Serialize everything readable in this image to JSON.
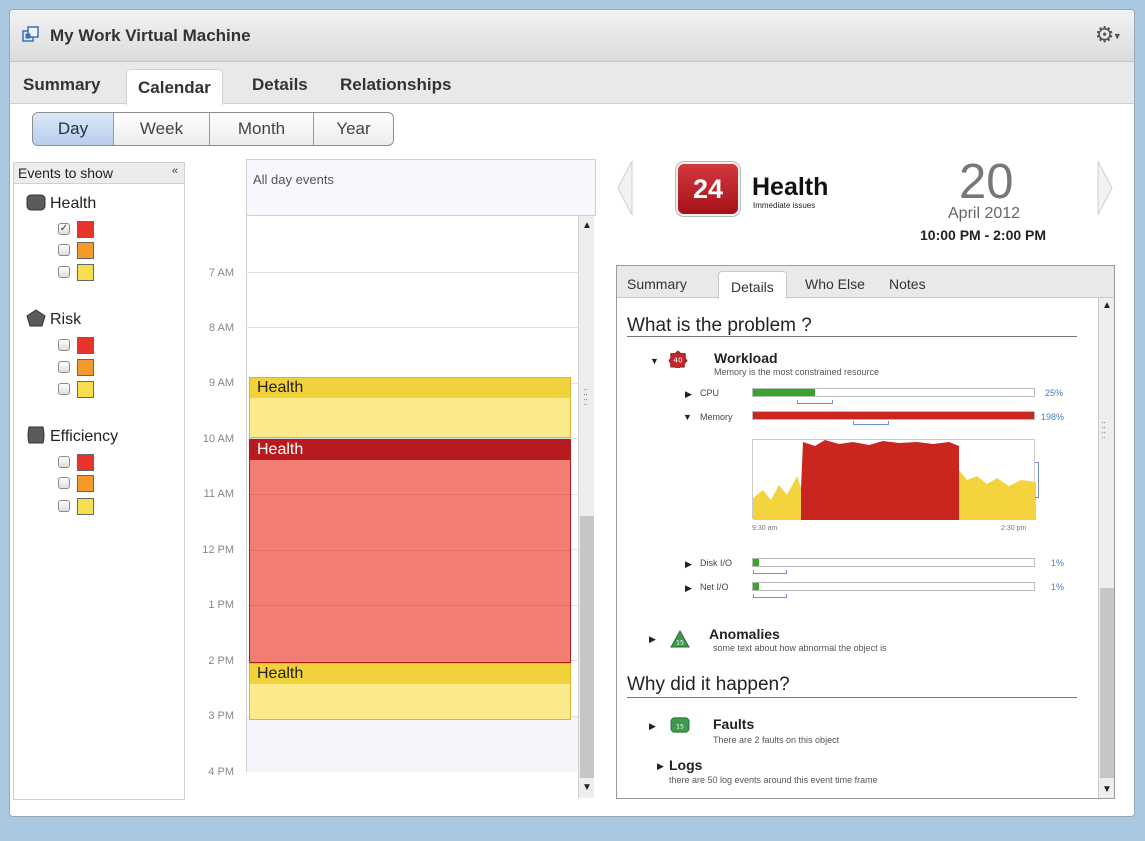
{
  "window": {
    "title": "My Work Virtual Machine"
  },
  "tabs": [
    "Summary",
    "Calendar",
    "Details",
    "Relationships"
  ],
  "active_tab": "Calendar",
  "view_toggle": {
    "options": [
      "Day",
      "Week",
      "Month",
      "Year"
    ],
    "selected": "Day"
  },
  "events_panel": {
    "header": "Events to show",
    "groups": [
      {
        "label": "Health",
        "icon": "square-badge-icon",
        "rows": [
          {
            "checked": true,
            "color": "#e8332b"
          },
          {
            "checked": false,
            "color": "#f49a2a"
          },
          {
            "checked": false,
            "color": "#f7de4e"
          }
        ]
      },
      {
        "label": "Risk",
        "icon": "pentagon-badge-icon",
        "rows": [
          {
            "checked": false,
            "color": "#e8332b"
          },
          {
            "checked": false,
            "color": "#f49a2a"
          },
          {
            "checked": false,
            "color": "#f7de4e"
          }
        ]
      },
      {
        "label": "Efficiency",
        "icon": "rounded-badge-icon",
        "rows": [
          {
            "checked": false,
            "color": "#e8332b"
          },
          {
            "checked": false,
            "color": "#f49a2a"
          },
          {
            "checked": false,
            "color": "#f7de4e"
          }
        ]
      }
    ]
  },
  "calendar": {
    "all_day_label": "All day events",
    "hours": [
      "7 AM",
      "8 AM",
      "9 AM",
      "10 AM",
      "11 AM",
      "12 PM",
      "1 PM",
      "2 PM",
      "3 PM",
      "4 PM"
    ],
    "events": [
      {
        "label": "Health",
        "start": "9 AM",
        "end": "10 AM",
        "severity": "warning"
      },
      {
        "label": "Health",
        "start": "10 AM",
        "end": "2 PM",
        "severity": "critical"
      },
      {
        "label": "Health",
        "start": "2 PM",
        "end": "3 PM",
        "severity": "warning"
      }
    ]
  },
  "detail_header": {
    "badge_value": "24",
    "title": "Health",
    "subtitle": "Immediate issues",
    "day": "20",
    "month_year": "April 2012",
    "time_range": "10:00 PM - 2:00 PM"
  },
  "detail_tabs": {
    "tabs": [
      "Summary",
      "Details",
      "Who Else",
      "Notes"
    ],
    "active": "Details"
  },
  "problem": {
    "heading": "What is the problem ?",
    "workload": {
      "badge": "40",
      "title": "Workload",
      "subtitle": "Memory is the most constrained resource",
      "metrics": [
        {
          "label": "CPU",
          "pct_text": "25%",
          "fill": 0.22,
          "color": "#3aa32b",
          "expanded": false
        },
        {
          "label": "Memory",
          "pct_text": "198%",
          "fill": 1.0,
          "color": "#c8261f",
          "expanded": true
        },
        {
          "label": "Disk I/O",
          "pct_text": "1%",
          "fill": 0.02,
          "color": "#3aa32b",
          "expanded": false
        },
        {
          "label": "Net I/O",
          "pct_text": "1%",
          "fill": 0.02,
          "color": "#3aa32b",
          "expanded": false
        }
      ],
      "chart": {
        "x_start": "9:30 am",
        "x_end": "2:30 pm"
      }
    },
    "anomalies": {
      "badge": "15",
      "title": "Anomalies",
      "subtitle": "some text about how abnormal the object is"
    }
  },
  "cause": {
    "heading": "Why did it happen?",
    "faults": {
      "badge": "15",
      "title": "Faults",
      "subtitle": "There are 2 faults on this object"
    },
    "logs": {
      "title": "Logs",
      "subtitle": "there are 50 log events around this event time frame"
    }
  }
}
